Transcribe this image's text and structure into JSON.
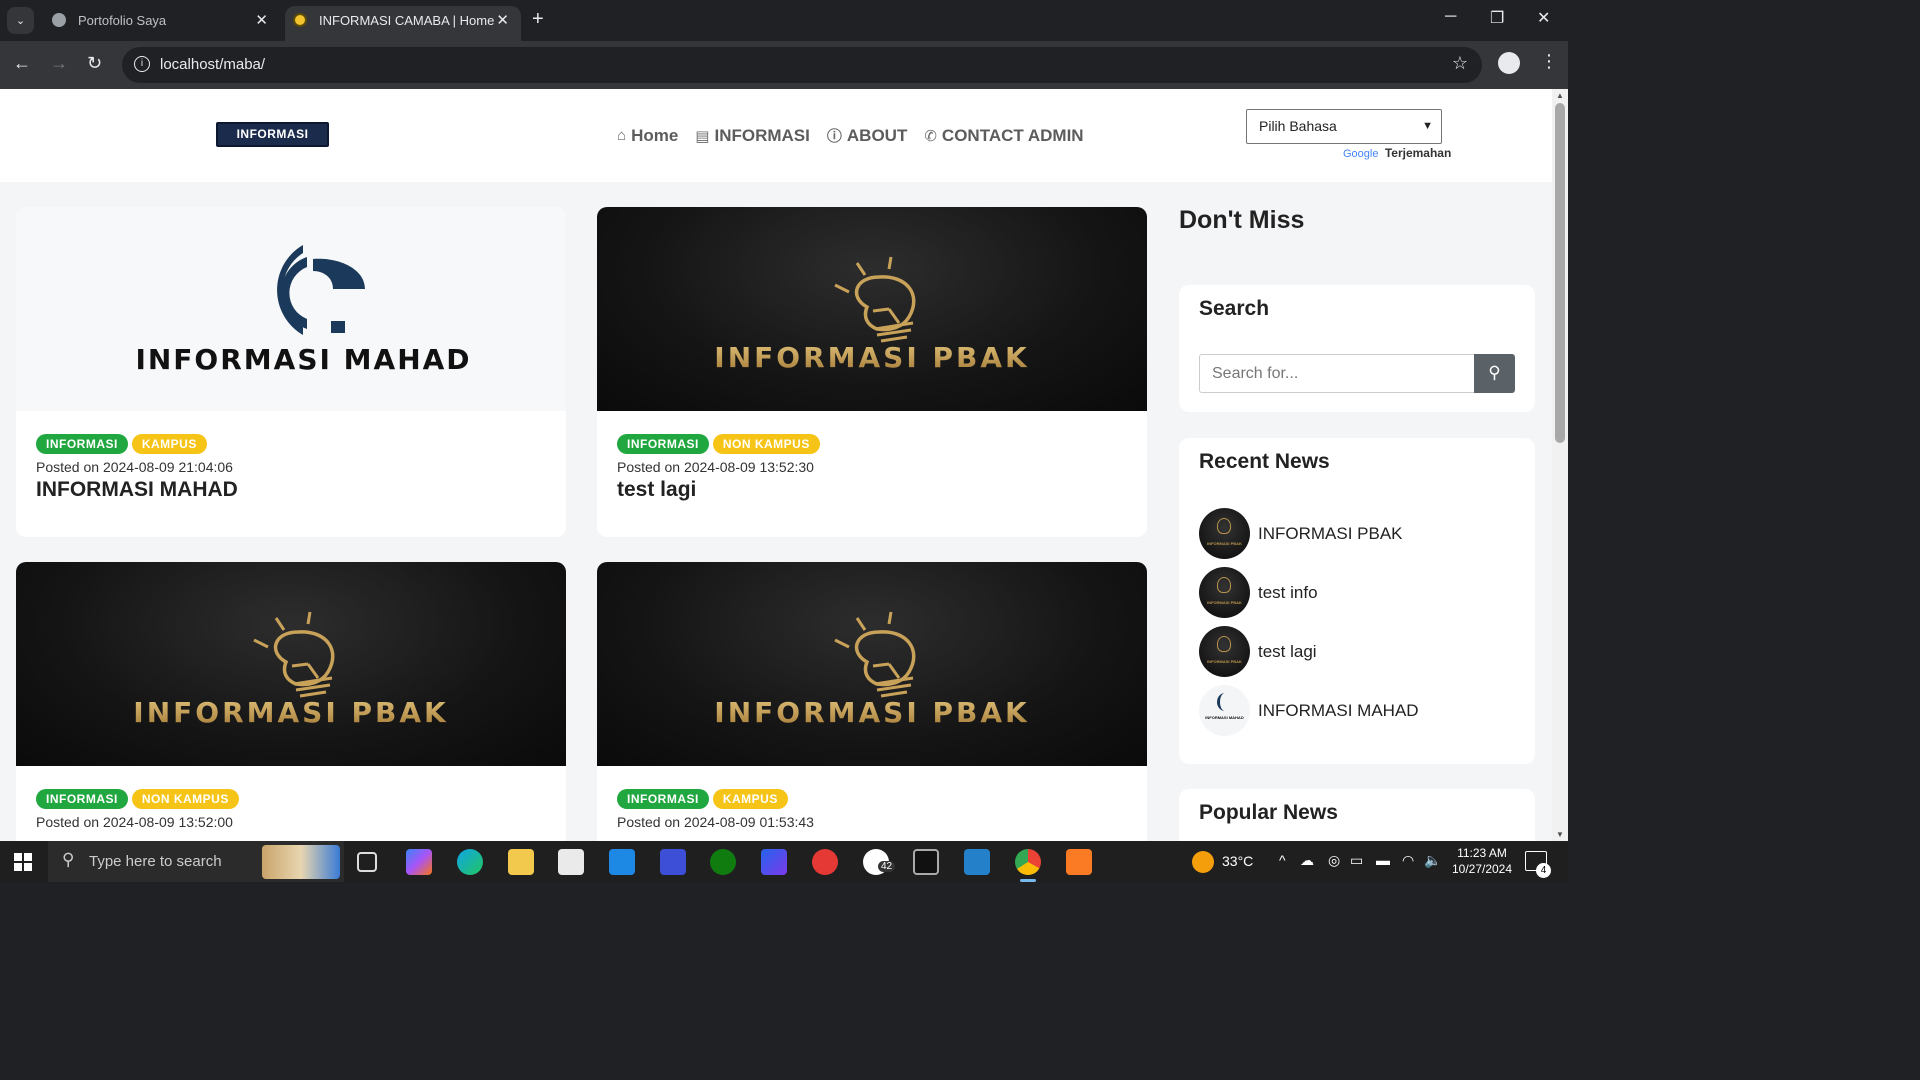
{
  "browser": {
    "tabs": [
      {
        "title": "Portofolio Saya",
        "active": false
      },
      {
        "title": "INFORMASI CAMABA | Home",
        "active": true
      }
    ],
    "url": "localhost/maba/"
  },
  "site": {
    "logo_text": "INFORMASI MABA",
    "nav": [
      {
        "label": "Home",
        "icon": "home-icon"
      },
      {
        "label": "INFORMASI",
        "icon": "newspaper-icon"
      },
      {
        "label": "ABOUT",
        "icon": "info-circle-icon"
      },
      {
        "label": "CONTACT ADMIN",
        "icon": "phone-icon"
      }
    ],
    "language_select": "Pilih Bahasa",
    "translate_brand": "Google",
    "translate_label": "Terjemahan"
  },
  "posts": [
    {
      "image_text": "INFORMASI MAHAD",
      "tags": [
        "INFORMASI",
        "KAMPUS"
      ],
      "posted": "Posted on 2024-08-09 21:04:06",
      "title": "INFORMASI MAHAD"
    },
    {
      "image_text": "INFORMASI PBAK",
      "tags": [
        "INFORMASI",
        "NON KAMPUS"
      ],
      "posted": "Posted on 2024-08-09 13:52:30",
      "title": "test lagi"
    },
    {
      "image_text": "INFORMASI PBAK",
      "tags": [
        "INFORMASI",
        "NON KAMPUS"
      ],
      "posted": "Posted on 2024-08-09 13:52:00",
      "title": ""
    },
    {
      "image_text": "INFORMASI PBAK",
      "tags": [
        "INFORMASI",
        "KAMPUS"
      ],
      "posted": "Posted on 2024-08-09 01:53:43",
      "title": ""
    }
  ],
  "sidebar": {
    "heading": "Don't Miss",
    "search_title": "Search",
    "search_placeholder": "Search for...",
    "recent_title": "Recent News",
    "recent": [
      {
        "label": "INFORMASI PBAK",
        "thumb": "pbak",
        "thumb_text": "INFORMASI PBAK"
      },
      {
        "label": "test info",
        "thumb": "pbak",
        "thumb_text": "INFORMASI PBAK"
      },
      {
        "label": "test lagi",
        "thumb": "pbak",
        "thumb_text": "INFORMASI PBAK"
      },
      {
        "label": "INFORMASI MAHAD",
        "thumb": "mahad",
        "thumb_text": "INFORMASI MAHAD"
      }
    ],
    "popular_title": "Popular News"
  },
  "taskbar": {
    "search_placeholder": "Type here to search",
    "whatsapp_badge": "42",
    "weather": "33°C",
    "time": "11:23 AM",
    "date": "10/27/2024",
    "notifications": "4"
  },
  "colors": {
    "tag_green": "#21a73f",
    "tag_yellow": "#f6c416",
    "gold": "#b8924a",
    "navy": "#1b3a5b"
  }
}
